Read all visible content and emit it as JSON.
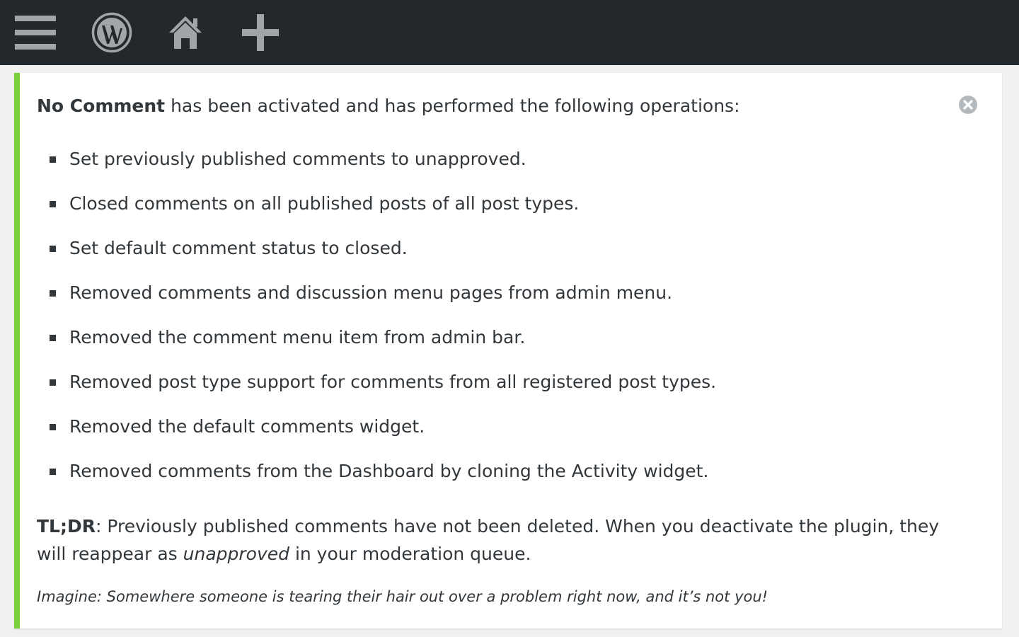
{
  "adminbar": {
    "background": "#23282d",
    "icon_color": "#a0a5aa",
    "items": [
      {
        "icon": "menu-icon"
      },
      {
        "icon": "wordpress-logo-icon"
      },
      {
        "icon": "home-icon"
      },
      {
        "icon": "plus-icon"
      }
    ]
  },
  "notice": {
    "type": "updated",
    "accent_color": "#7ad03a",
    "plugin_name": "No Comment",
    "heading_rest": " has been activated and has performed the following operations:",
    "dismiss_icon": "dismiss-icon",
    "operations": [
      "Set previously published comments to unapproved.",
      "Closed comments on all published posts of all post types.",
      "Set default comment status to closed.",
      "Removed comments and discussion menu pages from admin menu.",
      "Removed the comment menu item from admin bar.",
      "Removed post type support for comments from all registered post types.",
      "Removed the default comments widget.",
      "Removed comments from the Dashboard by cloning the Activity widget."
    ],
    "tldr": {
      "label": "TL;DR",
      "text_before": ": Previously published comments have not been deleted. When you deactivate the plugin, they will reappear as ",
      "emphasis": "unapproved",
      "text_after": " in your moderation queue."
    },
    "tagline": "Imagine: Somewhere someone is tearing their hair out over a problem right now, and it’s not you!"
  }
}
